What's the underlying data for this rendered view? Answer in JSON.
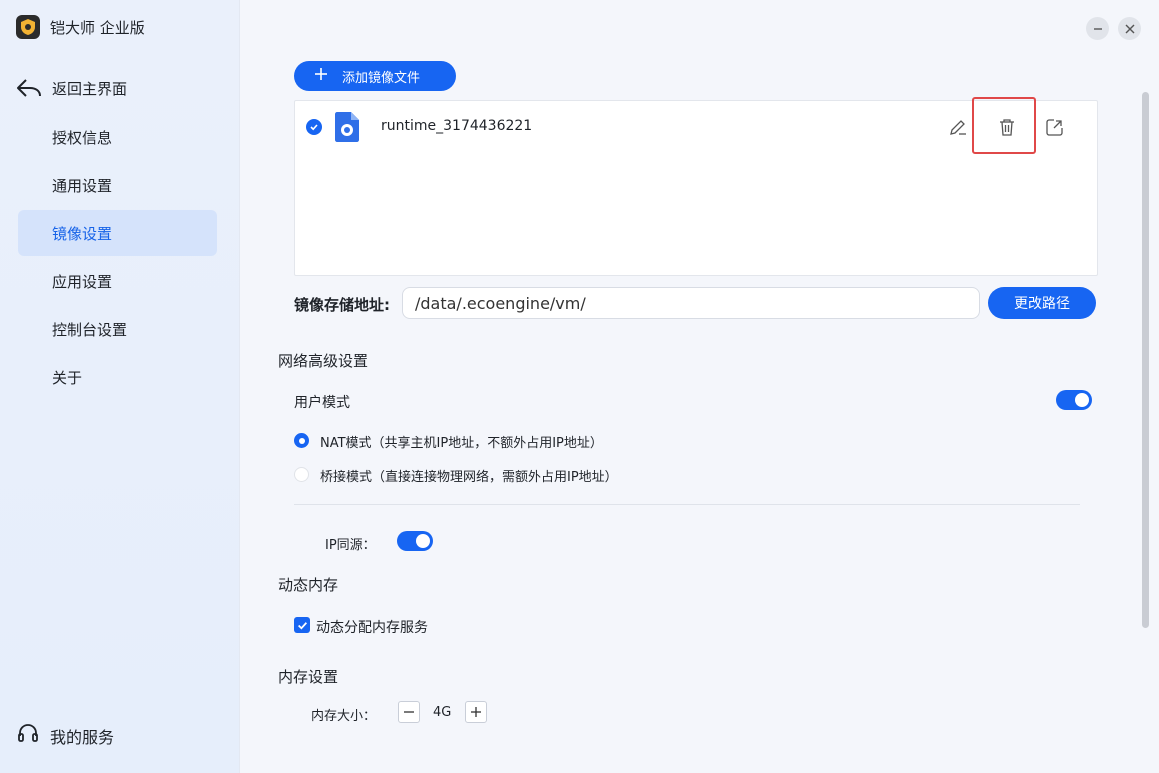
{
  "app": {
    "title": "铠大师 企业版",
    "logo_icon": "shield-logo-icon"
  },
  "sidebar": {
    "back_label": "返回主界面",
    "items": [
      {
        "label": "授权信息",
        "active": false
      },
      {
        "label": "通用设置",
        "active": false
      },
      {
        "label": "镜像设置",
        "active": true
      },
      {
        "label": "应用设置",
        "active": false
      },
      {
        "label": "控制台设置",
        "active": false
      },
      {
        "label": "关于",
        "active": false
      }
    ],
    "service_label": "我的服务"
  },
  "image_settings": {
    "add_button_label": "添加镜像文件",
    "files": [
      {
        "name": "runtime_3174436221",
        "selected": true
      }
    ],
    "storage_path_label": "镜像存储地址",
    "storage_path_colon": ":",
    "storage_path_value": "/data/.ecoengine/vm/",
    "change_path_label": "更改路径"
  },
  "network": {
    "title": "网络高级设置",
    "user_mode_label": "用户模式",
    "user_mode_enabled": true,
    "options": [
      {
        "label": "NAT模式（共享主机IP地址，不额外占用IP地址）",
        "selected": true
      },
      {
        "label": "桥接模式（直接连接物理网络，需额外占用IP地址）",
        "selected": false
      }
    ],
    "ip_same_source_label": "IP同源：",
    "ip_same_source_enabled": true
  },
  "dynamic_memory": {
    "title": "动态内存",
    "checkbox_label": "动态分配内存服务",
    "checked": true
  },
  "memory": {
    "title": "内存设置",
    "size_label": "内存大小：",
    "size_value": "4G"
  },
  "colors": {
    "accent": "#1765f2",
    "sidebar_active_bg": "#d5e3fb",
    "highlight_box": "#e04848"
  }
}
